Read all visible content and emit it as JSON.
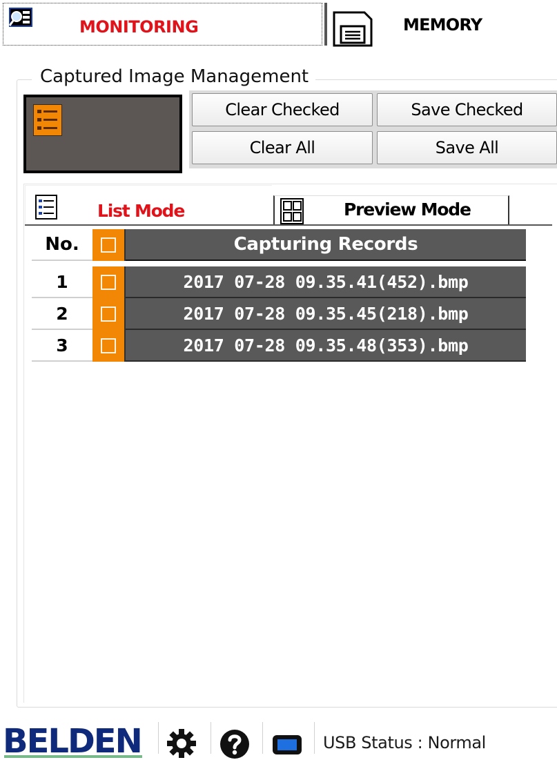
{
  "top_tabs": {
    "monitoring_label": "MONITORING",
    "memory_label": "MEMORY"
  },
  "capture_group": {
    "title": "Captured Image Management",
    "buttons": {
      "clear_checked": "Clear Checked",
      "save_checked": "Save Checked",
      "clear_all": "Clear All",
      "save_all": "Save All"
    }
  },
  "mode_tabs": {
    "list_label": "List Mode",
    "preview_label": "Preview Mode",
    "active": "List Mode"
  },
  "records_table": {
    "headers": {
      "number": "No.",
      "record": "Capturing Records"
    },
    "rows": [
      {
        "number": "1",
        "record": "2017 07-28 09.35.41(452).bmp",
        "checked": false
      },
      {
        "number": "2",
        "record": "2017 07-28 09.35.45(218).bmp",
        "checked": false
      },
      {
        "number": "3",
        "record": "2017 07-28 09.35.48(353).bmp",
        "checked": false
      }
    ]
  },
  "footer": {
    "logo_text": "BELDEN",
    "usb_status": "USB Status : Normal",
    "icons": [
      "gear-icon",
      "help-icon",
      "usb-device-icon"
    ]
  },
  "colors": {
    "accent_red": "#e0131b",
    "checkbox_orange": "#f28705",
    "record_bg": "#595959",
    "logo_blue": "#0f2a7a"
  }
}
